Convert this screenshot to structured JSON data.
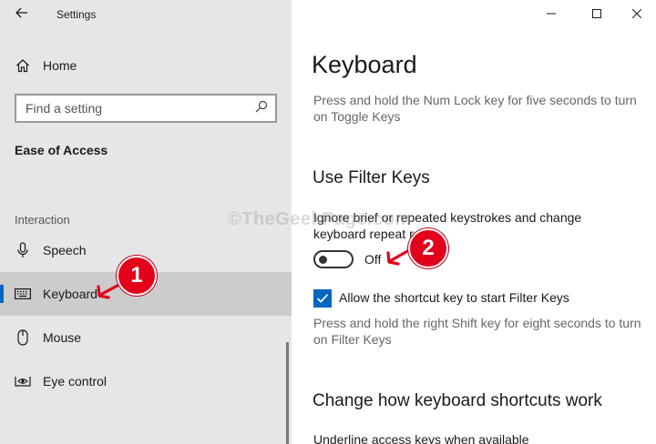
{
  "app": {
    "title": "Settings"
  },
  "window": {
    "minimize_glyph": "—",
    "maximize_glyph": "☐",
    "close_glyph": "✕"
  },
  "sidebar": {
    "home_label": "Home",
    "search_placeholder": "Find a setting",
    "section_title": "Ease of Access",
    "group_label": "Interaction",
    "items": [
      {
        "label": "Speech",
        "icon": "microphone-icon",
        "selected": false
      },
      {
        "label": "Keyboard",
        "icon": "keyboard-icon",
        "selected": true
      },
      {
        "label": "Mouse",
        "icon": "mouse-icon",
        "selected": false
      },
      {
        "label": "Eye control",
        "icon": "eye-icon",
        "selected": false
      }
    ]
  },
  "main": {
    "title": "Keyboard",
    "toggle_keys_desc": "Press and hold the Num Lock key for five seconds to turn on Toggle Keys",
    "filter_keys": {
      "heading": "Use Filter Keys",
      "setting_text": "Ignore brief or repeated keystrokes and change keyboard repeat r",
      "toggle_state": "Off",
      "toggle_on": false,
      "checkbox_label": "Allow the shortcut key to start Filter Keys",
      "checkbox_checked": true,
      "shortcut_desc": "Press and hold the right Shift key for eight seconds to turn on Filter Keys"
    },
    "shortcuts": {
      "heading": "Change how keyboard shortcuts work",
      "underline_label": "Underline access keys when available"
    }
  },
  "watermark": "©TheGeekPage.com",
  "annotations": [
    {
      "number": "1"
    },
    {
      "number": "2"
    }
  ],
  "colors": {
    "accent": "#0067c0",
    "annotation": "#e3001b",
    "sidebar_bg": "#e6e6e6",
    "selected_bg": "#cccccc"
  }
}
